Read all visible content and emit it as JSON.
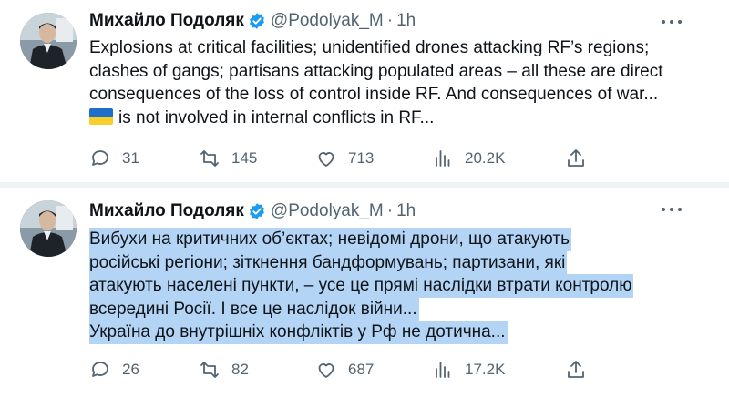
{
  "tweets": [
    {
      "author_name": "Михайло Подоляк",
      "handle": "@Podolyak_M",
      "separator": "·",
      "time": "1h",
      "lines": [
        "Explosions at critical facilities; unidentified drones attacking RF’s regions;",
        "clashes of gangs; partisans attacking populated areas – all these are direct",
        "consequences of the loss of control inside RF. And consequences of war...",
        "is not involved in internal conflicts in RF..."
      ],
      "flag_icon": "ukraine-flag-icon",
      "replies": "31",
      "retweets": "145",
      "likes": "713",
      "views": "20.2K"
    },
    {
      "author_name": "Михайло Подоляк",
      "handle": "@Podolyak_M",
      "separator": "·",
      "time": "1h",
      "lines": [
        "Вибухи на критичних об’єктах; невідомі дрони, що атакують",
        "російські регіони; зіткнення бандформувань; партизани, які",
        "атакують населені пункти, – усе це прямі наслідки втрати контролю",
        "всередині Росії. І все це наслідок війни...",
        "Україна до внутрішніх конфліктів у Рф не дотична..."
      ],
      "replies": "26",
      "retweets": "82",
      "likes": "687",
      "views": "17.2K"
    }
  ],
  "colors": {
    "text": "#0f1419",
    "secondary": "#536471",
    "verified": "#1d9bf0",
    "highlight": "#b3d4f5",
    "separator": "#eff3f4"
  },
  "icons": [
    "verified-badge-icon",
    "more-icon",
    "reply-icon",
    "retweet-icon",
    "like-icon",
    "views-icon",
    "share-icon"
  ]
}
